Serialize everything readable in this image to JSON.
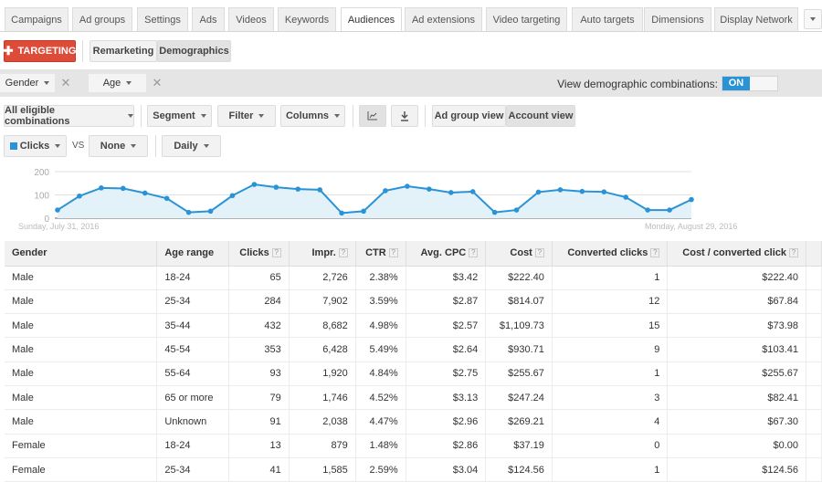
{
  "tabs": [
    "Campaigns",
    "Ad groups",
    "Settings",
    "Ads",
    "Videos",
    "Keywords",
    "Audiences",
    "Ad extensions",
    "Video targeting",
    "Auto targets",
    "Dimensions",
    "Display Network"
  ],
  "active_tab": "Audiences",
  "targeting_button": "TARGETING",
  "subtabs": {
    "remarketing": "Remarketing",
    "demographics": "Demographics"
  },
  "filters": {
    "gender": "Gender",
    "age": "Age",
    "combinations_label": "View demographic combinations:",
    "toggle_state": "ON"
  },
  "toolbar": {
    "combinations": "All eligible combinations",
    "segment": "Segment",
    "filter": "Filter",
    "columns": "Columns",
    "ad_group_view": "Ad group view",
    "account_view": "Account view"
  },
  "chart_controls": {
    "metric": "Clicks",
    "vs": "VS",
    "compare": "None",
    "period": "Daily"
  },
  "colors": {
    "accent": "#2a93d5",
    "targeting": "#dd4b39"
  },
  "chart_data": {
    "type": "area",
    "series": [
      {
        "name": "Clicks",
        "values": [
          35,
          95,
          130,
          128,
          108,
          85,
          25,
          30,
          97,
          145,
          133,
          125,
          122,
          22,
          30,
          118,
          137,
          125,
          110,
          114,
          25,
          35,
          112,
          122,
          115,
          113,
          90,
          35,
          35,
          80
        ]
      }
    ],
    "ylim": [
      0,
      200
    ],
    "yticks": [
      "200",
      "100",
      "0"
    ],
    "start_label": "Sunday, July 31, 2016",
    "end_label": "Monday, August 29, 2016",
    "grid": true
  },
  "table": {
    "headers": [
      "Gender",
      "Age range",
      "Clicks",
      "Impr.",
      "CTR",
      "Avg. CPC",
      "Cost",
      "Converted clicks",
      "Cost / converted click"
    ],
    "rows": [
      [
        "Male",
        "18-24",
        "65",
        "2,726",
        "2.38%",
        "$3.42",
        "$222.40",
        "1",
        "$222.40"
      ],
      [
        "Male",
        "25-34",
        "284",
        "7,902",
        "3.59%",
        "$2.87",
        "$814.07",
        "12",
        "$67.84"
      ],
      [
        "Male",
        "35-44",
        "432",
        "8,682",
        "4.98%",
        "$2.57",
        "$1,109.73",
        "15",
        "$73.98"
      ],
      [
        "Male",
        "45-54",
        "353",
        "6,428",
        "5.49%",
        "$2.64",
        "$930.71",
        "9",
        "$103.41"
      ],
      [
        "Male",
        "55-64",
        "93",
        "1,920",
        "4.84%",
        "$2.75",
        "$255.67",
        "1",
        "$255.67"
      ],
      [
        "Male",
        "65 or more",
        "79",
        "1,746",
        "4.52%",
        "$3.13",
        "$247.24",
        "3",
        "$82.41"
      ],
      [
        "Male",
        "Unknown",
        "91",
        "2,038",
        "4.47%",
        "$2.96",
        "$269.21",
        "4",
        "$67.30"
      ],
      [
        "Female",
        "18-24",
        "13",
        "879",
        "1.48%",
        "$2.86",
        "$37.19",
        "0",
        "$0.00"
      ],
      [
        "Female",
        "25-34",
        "41",
        "1,585",
        "2.59%",
        "$3.04",
        "$124.56",
        "1",
        "$124.56"
      ]
    ]
  }
}
